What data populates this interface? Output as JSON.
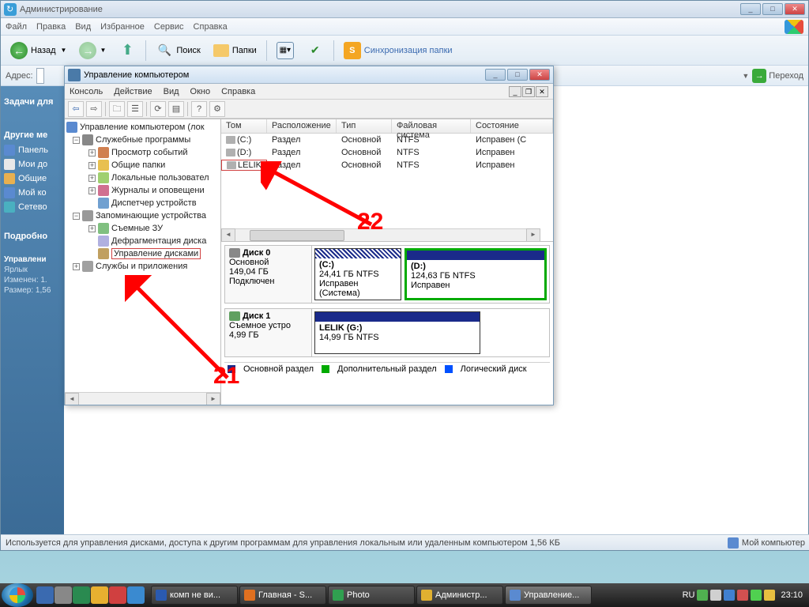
{
  "admin": {
    "title": "Администрирование",
    "menu": [
      "Файл",
      "Правка",
      "Вид",
      "Избранное",
      "Сервис",
      "Справка"
    ],
    "toolbar": {
      "back": "Назад",
      "search": "Поиск",
      "folders": "Папки",
      "sync": "Синхронизация папки"
    },
    "addr_label": "Адрес:",
    "go_label": "Переход"
  },
  "sidepanel": {
    "tasks_head": "Задачи для",
    "other_head": "Другие ме",
    "items": [
      {
        "icon": "cp",
        "label": "Панель"
      },
      {
        "icon": "doc",
        "label": "Мои до"
      },
      {
        "icon": "folder",
        "label": "Общие"
      },
      {
        "icon": "cp",
        "label": "Мой ко"
      },
      {
        "icon": "net",
        "label": "Сетево"
      }
    ],
    "details_head": "Подробно",
    "details_title": "Управлени",
    "details_type": "Ярлык",
    "details_mod": "Изменен: 1.",
    "details_size": "Размер: 1,56"
  },
  "mmc": {
    "title": "Управление компьютером",
    "menu": [
      "Консоль",
      "Действие",
      "Вид",
      "Окно",
      "Справка"
    ],
    "tree": {
      "root": "Управление компьютером (лок",
      "sys_tools": "Служебные программы",
      "sys_children": [
        "Просмотр событий",
        "Общие папки",
        "Локальные пользовател",
        "Журналы и оповещени",
        "Диспетчер устройств"
      ],
      "storage": "Запоминающие устройства",
      "stor_children": [
        "Съемные ЗУ",
        "Дефрагментация диска",
        "Управление дисками"
      ],
      "services": "Службы и приложения"
    },
    "vol_headers": [
      "Том",
      "Расположение",
      "Тип",
      "Файловая система",
      "Состояние"
    ],
    "volumes": [
      {
        "name": "(C:)",
        "layout": "Раздел",
        "type": "Основной",
        "fs": "NTFS",
        "status": "Исправен (С"
      },
      {
        "name": "(D:)",
        "layout": "Раздел",
        "type": "Основной",
        "fs": "NTFS",
        "status": "Исправен"
      },
      {
        "name": "LELIK",
        "layout": "Раздел",
        "type": "Основной",
        "fs": "NTFS",
        "status": "Исправен"
      }
    ],
    "disks": [
      {
        "name": "Диск 0",
        "type": "Основной",
        "size": "149,04 ГБ",
        "status": "Подключен",
        "parts": [
          {
            "label": "(C:)",
            "sz": "24,41 ГБ NTFS",
            "st": "Исправен (Система)",
            "hatch": true,
            "green": false
          },
          {
            "label": "(D:)",
            "sz": "124,63 ГБ NTFS",
            "st": "Исправен",
            "hatch": false,
            "green": true
          }
        ]
      },
      {
        "name": "Диск 1",
        "type": "Съемное устро",
        "size": "4,99 ГБ",
        "status": "",
        "parts": [
          {
            "label": "LELIK  (G:)",
            "sz": "14,99 ГБ NTFS",
            "st": "",
            "hatch": false,
            "green": false
          }
        ]
      }
    ],
    "legend": [
      "Основной раздел",
      "Дополнительный раздел",
      "Логический диск"
    ]
  },
  "annotations": {
    "n21": "21",
    "n22": "22"
  },
  "status": {
    "text": "Используется для управления дисками, доступа к другим программам для управления локальным или удаленным компьютером 1,56 КБ",
    "right": "Мой компьютер"
  },
  "taskbar": {
    "tasks": [
      {
        "label": "комп не ви...",
        "color": "#2a5ab0"
      },
      {
        "label": "Главная - S...",
        "color": "#e07020"
      },
      {
        "label": "Photo",
        "color": "#30a050"
      },
      {
        "label": "Администр...",
        "color": "#e0b030"
      },
      {
        "label": "Управление...",
        "color": "#5a8ad0"
      }
    ],
    "lang": "RU",
    "clock": "23:10"
  }
}
